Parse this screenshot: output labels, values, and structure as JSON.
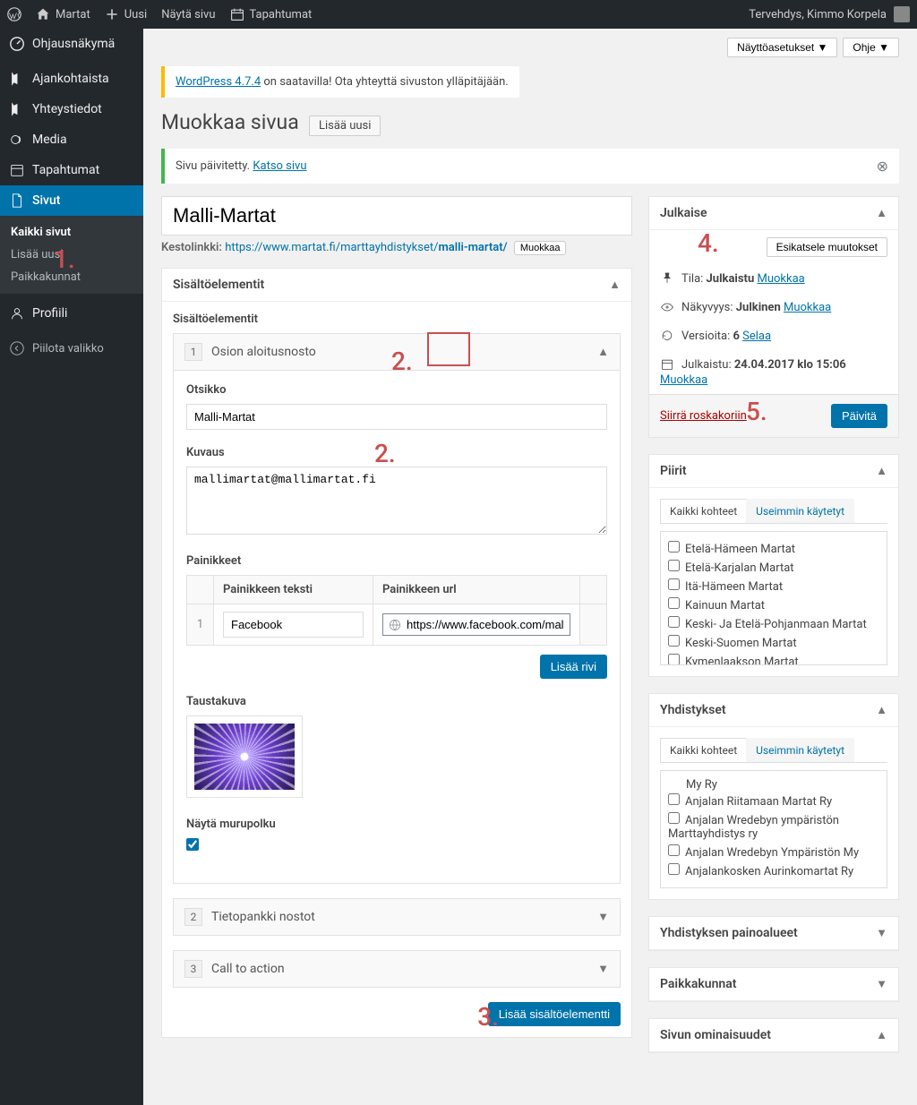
{
  "topbar": {
    "site": "Martat",
    "new": "Uusi",
    "view_page": "Näytä sivu",
    "events": "Tapahtumat",
    "greeting": "Tervehdys, Kimmo Korpela"
  },
  "sidebar": {
    "dashboard": "Ohjausnäkymä",
    "news": "Ajankohtaista",
    "contacts": "Yhteystiedot",
    "media": "Media",
    "events": "Tapahtumat",
    "pages": "Sivut",
    "sub_all": "Kaikki sivut",
    "sub_new": "Lisää uusi",
    "sub_localities": "Paikkakunnat",
    "profile": "Profiili",
    "collapse": "Piilota valikko"
  },
  "screen": {
    "options": "Näyttöasetukset",
    "help": "Ohje"
  },
  "notices": {
    "update_link": "WordPress 4.7.4",
    "update_text": " on saatavilla! Ota yhteyttä sivuston ylläpitäjään.",
    "success_text": "Sivu päivitetty. ",
    "success_link": "Katso sivu"
  },
  "page": {
    "heading": "Muokkaa sivua",
    "add_new": "Lisää uusi",
    "title_value": "Malli-Martat",
    "permalink_label": "Kestolinkki:",
    "permalink_base": "https://www.martat.fi/marttayhdistykset/",
    "permalink_slug": "malli-martat/",
    "edit": "Muokkaa"
  },
  "content": {
    "box_title": "Sisältöelementit",
    "legend": "Sisältöelementit",
    "sections": [
      {
        "num": "1",
        "name": "Osion aloitusnosto"
      },
      {
        "num": "2",
        "name": "Tietopankki nostot"
      },
      {
        "num": "3",
        "name": "Call to action"
      }
    ],
    "title_label": "Otsikko",
    "title_value": "Malli-Martat",
    "desc_label": "Kuvaus",
    "desc_value": "mallimartat@mallimartat.fi",
    "buttons_label": "Painikkeet",
    "btn_text_header": "Painikkeen teksti",
    "btn_url_header": "Painikkeen url",
    "btn_text_value": "Facebook",
    "btn_url_value": "https://www.facebook.com/mallimartat",
    "add_row": "Lisää rivi",
    "bg_label": "Taustakuva",
    "breadcrumb_label": "Näytä murupolku",
    "add_element": "Lisää sisältöelementti"
  },
  "publish": {
    "title": "Julkaise",
    "preview": "Esikatsele muutokset",
    "status_label": "Tila:",
    "status_value": "Julkaistu",
    "visibility_label": "Näkyvyys:",
    "visibility_value": "Julkinen",
    "revisions_label": "Versioita:",
    "revisions_value": "6",
    "browse": "Selaa",
    "published_label": "Julkaistu:",
    "published_value": "24.04.2017 klo 15:06",
    "edit": "Muokkaa",
    "trash": "Siirrä roskakoriin",
    "update": "Päivitä"
  },
  "piirit": {
    "title": "Piirit",
    "tab_all": "Kaikki kohteet",
    "tab_used": "Useimmin käytetyt",
    "items": [
      "Etelä-Hämeen Martat",
      "Etelä-Karjalan Martat",
      "Itä-Hämeen Martat",
      "Kainuun Martat",
      "Keski- Ja Etelä-Pohjanmaan Martat",
      "Keski-Suomen Martat",
      "Kymenlaakson Martat"
    ]
  },
  "yhdistykset": {
    "title": "Yhdistykset",
    "tab_all": "Kaikki kohteet",
    "tab_used": "Useimmin käytetyt",
    "items": [
      "Anjalan Riitamaan Martat Ry",
      "Anjalan Wredebyn ympäristön Marttayhdistys ry",
      "Anjalan Wredebyn Ympäristön My",
      "Anjalankosken Aurinkomartat Ry"
    ],
    "partial_first": "My Ry"
  },
  "side_boxes": {
    "painoalueet": "Yhdistyksen painoalueet",
    "paikkakunnat": "Paikkakunnat",
    "ominaisuudet": "Sivun ominaisuudet"
  },
  "annotations": {
    "a1": "1.",
    "a2a": "2.",
    "a2b": "2.",
    "a3": "3.",
    "a4": "4.",
    "a5": "5."
  }
}
